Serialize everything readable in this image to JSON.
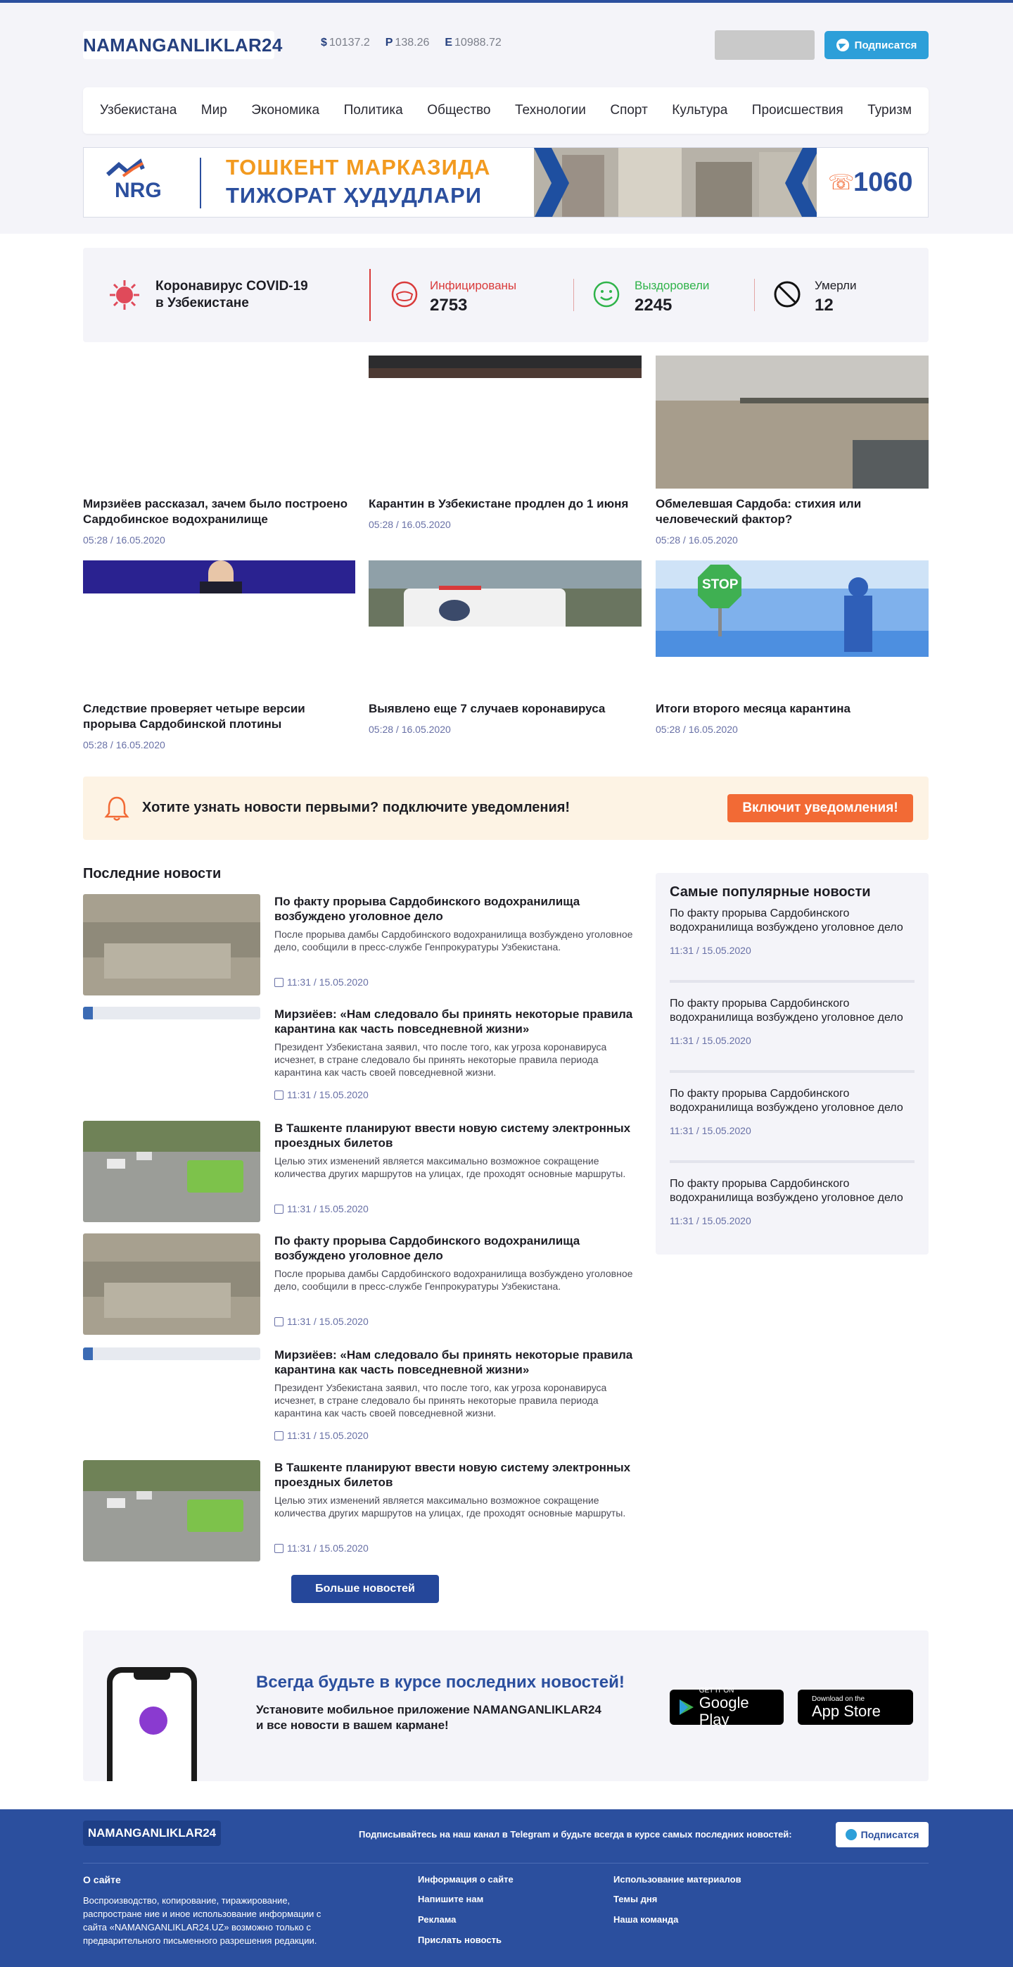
{
  "site": {
    "logo": "NAMANGANLIKLAR24"
  },
  "rates": [
    {
      "symbol": "$",
      "value": "10137.2"
    },
    {
      "symbol": "Р",
      "value": "138.26"
    },
    {
      "symbol": "Е",
      "value": "10988.72"
    }
  ],
  "header": {
    "subscribe_label": "Подписатся"
  },
  "nav": [
    "Узбекистана",
    "Мир",
    "Экономика",
    "Политика",
    "Общество",
    "Технологии",
    "Спорт",
    "Культура",
    "Происшествия",
    "Туризм"
  ],
  "banner": {
    "brand": "NRG",
    "line1": "ТОШКЕНТ МАРКАЗИДА",
    "line2": "ТИЖОРАТ ҲУДУДЛАРИ",
    "phone": "1060"
  },
  "covid": {
    "title_line1": "Коронавирус COVID-19",
    "title_line2": "в Узбекистане",
    "infected_label": "Инфицированы",
    "infected_value": "2753",
    "recovered_label": "Выздоровели",
    "recovered_value": "2245",
    "died_label": "Умерли",
    "died_value": "12"
  },
  "grid_news": [
    {
      "title": "Мирзиёев рассказал, зачем было построено Сардобинское водохранилище",
      "date": "05:28 / 16.05.2020"
    },
    {
      "title": "Карантин в Узбекистане продлен до 1 июня",
      "date": "05:28 / 16.05.2020"
    },
    {
      "title": "Обмелевшая Сардоба: стихия или человеческий фактор?",
      "date": "05:28 / 16.05.2020"
    },
    {
      "title": "Следствие проверяет четыре версии прорыва Сардобинской плотины",
      "date": "05:28 / 16.05.2020"
    },
    {
      "title": "Выявлено еще 7 случаев коронавируса",
      "date": "05:28 / 16.05.2020"
    },
    {
      "title": "Итоги второго месяца карантина",
      "date": "05:28 / 16.05.2020"
    }
  ],
  "stop_sign": "STOP",
  "notification": {
    "text": "Хотите узнать новости первыми? подключите уведомления!",
    "button": "Включит  уведомления!"
  },
  "latest": {
    "title": "Последние новости",
    "items": [
      {
        "title": "По факту прорыва Сардобинского водохранилища возбуждено уголовное дело",
        "desc": "После прорыва дамбы Сардобинского водохранилища возбуждено уголовное дело, сообщили в пресс-службе Генпрокуратуры Узбекистана.",
        "date": "11:31 / 15.05.2020"
      },
      {
        "title": "Мирзиёев: «Нам следовало бы принять некоторые правила карантина как часть повседневной жизни»",
        "desc": "Президент Узбекистана заявил, что после того, как угроза коронавируса исчезнет, в стране следовало бы принять некоторые правила периода карантина как часть своей повседневной жизни.",
        "date": "11:31 / 15.05.2020"
      },
      {
        "title": "В Ташкенте планируют ввести новую систему электронных проездных билетов",
        "desc": "Целью этих изменений является максимально возможное сокращение количества других маршрутов на улицах, где проходят основные маршруты.",
        "date": "11:31 / 15.05.2020"
      },
      {
        "title": "По факту прорыва Сардобинского водохранилища возбуждено уголовное дело",
        "desc": "После прорыва дамбы Сардобинского водохранилища возбуждено уголовное дело, сообщили в пресс-службе Генпрокуратуры Узбекистана.",
        "date": "11:31 / 15.05.2020"
      },
      {
        "title": "Мирзиёев: «Нам следовало бы принять некоторые правила карантина как часть повседневной жизни»",
        "desc": "Президент Узбекистана заявил, что после того, как угроза коронавируса исчезнет, в стране следовало бы принять некоторые правила периода карантина как часть своей повседневной жизни.",
        "date": "11:31 / 15.05.2020"
      },
      {
        "title": "В Ташкенте планируют ввести новую систему электронных проездных билетов",
        "desc": "Целью этих изменений является максимально возможное сокращение количества других маршрутов на улицах, где проходят основные маршруты.",
        "date": "11:31 / 15.05.2020"
      }
    ],
    "more_button": "Больше новостей"
  },
  "popular": {
    "title": "Самые популярные новости",
    "items": [
      {
        "title": "По факту прорыва Сардобинского водохранилища возбуждено уголовное дело",
        "date": "11:31 / 15.05.2020"
      },
      {
        "title": "По факту прорыва Сардобинского водохранилища возбуждено уголовное дело",
        "date": "11:31 / 15.05.2020"
      },
      {
        "title": "По факту прорыва Сардобинского водохранилища возбуждено уголовное дело",
        "date": "11:31 / 15.05.2020"
      },
      {
        "title": "По факту прорыва Сардобинского водохранилища возбуждено уголовное дело",
        "date": "11:31 / 15.05.2020"
      }
    ]
  },
  "app_promo": {
    "title": "Всегда будьте в курсе последних новостей!",
    "text_line1": "Установите мобильное приложение NAMANGANLIKLAR24",
    "text_line2": "и все новости в вашем кармане!",
    "google_small": "GET IT ON",
    "google_big": "Google Play",
    "apple_small": "Download on the",
    "apple_big": "App Store"
  },
  "footer": {
    "logo": "NAMANGANLIKLAR24",
    "telegram_text": "Подписывайтесь на наш канал в Telegram и будьте всегда в курсе самых последних новостей:",
    "subscribe_label": "Подписатся",
    "about_title": "О сайте",
    "about_text": "Воспроизводство, копирование, тиражирование, распростране ние и иное использование информации с сайта «NAMANGANLIKLAR24.UZ» возможно только с предварительного письменного разрешения редакции.",
    "col2": [
      "Информация о сайте",
      "Напишите нам",
      "Реклама",
      "Прислать новость"
    ],
    "col3": [
      "Использование материалов",
      "Темы дня",
      "Наша команда"
    ]
  },
  "colors": {
    "brand": "#2b4f9e",
    "accent": "#f26a35",
    "telegram": "#2d9fd9",
    "infected": "#d93a3a",
    "recovered": "#2fb34a"
  }
}
